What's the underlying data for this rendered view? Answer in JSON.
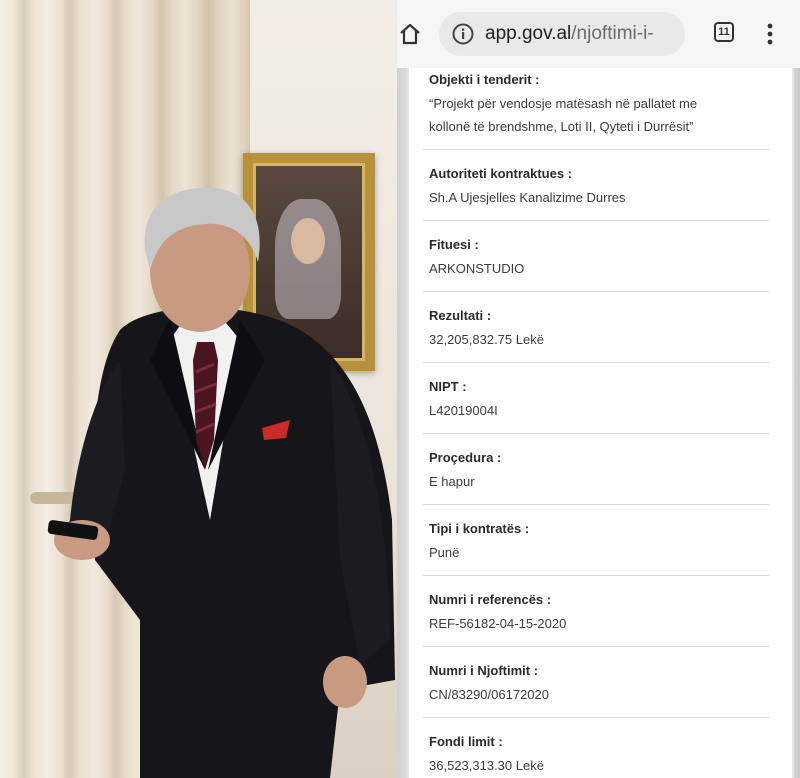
{
  "browser": {
    "url_host": "app.gov.al",
    "url_path": "/njoftimi-i-",
    "tab_count": "11"
  },
  "fields": [
    {
      "label": "Objekti i tenderit :",
      "value": "“Projekt për vendosje matësash në pallatet me kollonë të brendshme, Loti II, Qyteti i Durrësit”"
    },
    {
      "label": "Autoriteti kontraktues :",
      "value": "Sh.A Ujesjelles Kanalizime Durres"
    },
    {
      "label": "Fituesi :",
      "value": "ARKONSTUDIO"
    },
    {
      "label": "Rezultati :",
      "value": "32,205,832.75 Lekë"
    },
    {
      "label": "NIPT :",
      "value": "L42019004I"
    },
    {
      "label": "Proçedura :",
      "value": "E hapur"
    },
    {
      "label": "Tipi i kontratës :",
      "value": "Punë"
    },
    {
      "label": "Numri i referencës :",
      "value": "REF-56182-04-15-2020"
    },
    {
      "label": "Numri i Njoftimit :",
      "value": "CN/83290/06172020"
    },
    {
      "label": "Fondi limit :",
      "value": "36,523,313.30 Lekë"
    }
  ],
  "icons": [
    "home-icon",
    "info-icon",
    "tab-switcher-icon",
    "more-vert-icon"
  ],
  "colors": {
    "label": "#2b2b2b",
    "value": "#3c3c3c",
    "toolbar": "#f5f5f5",
    "url_pill": "#e9e9ea",
    "frame_gold": "#b8913c"
  }
}
